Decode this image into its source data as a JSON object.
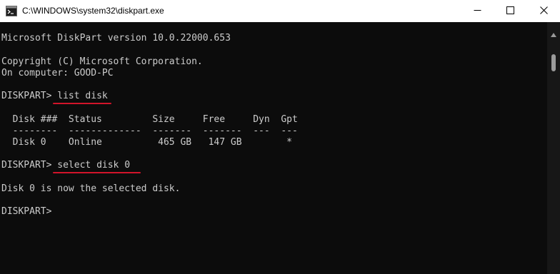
{
  "window": {
    "title": "C:\\WINDOWS\\system32\\diskpart.exe",
    "icon": "console-icon",
    "controls": {
      "minimize": "minimize-icon",
      "maximize": "maximize-icon",
      "close": "close-icon"
    }
  },
  "console": {
    "version_line": "Microsoft DiskPart version 10.0.22000.653",
    "copyright_line": "Copyright (C) Microsoft Corporation.",
    "computer_line": "On computer: GOOD-PC",
    "prompt": "DISKPART> ",
    "command1": "list disk",
    "table_header": "  Disk ###  Status         Size     Free     Dyn  Gpt",
    "table_separator": "  --------  -------------  -------  -------  ---  ---",
    "table_rows": [
      "  Disk 0    Online          465 GB   147 GB        *"
    ],
    "command2": "select disk 0",
    "result": "Disk 0 is now the selected disk.",
    "final_prompt": "DISKPART>"
  },
  "colors": {
    "console_bg": "#0c0c0c",
    "console_text": "#cccccc",
    "underline": "#d2142a"
  }
}
